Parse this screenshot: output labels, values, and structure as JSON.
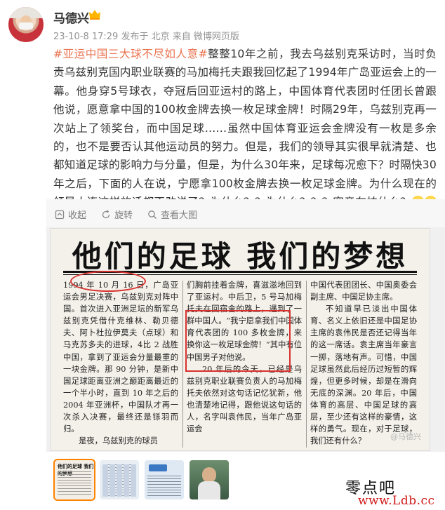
{
  "header": {
    "username": "马德兴",
    "meta": "23-10-8 17:29 发布于 北京 来自 微博网页版"
  },
  "post": {
    "hashtag": "#亚运中国三大球不尽如人意#",
    "body": "整整10年之前，我去乌兹别克采访时，当时负责乌兹别克国内职业联赛的马加梅托夫跟我回忆起了1994年广岛亚运会上的一幕。他身穿5号球衣，夺冠后回亚运村的路上，中国体育代表团时任团长曾跟他说，愿意拿中国的100枚金牌去换一枚足球金牌！时隔29年，乌兹别克再一次站上了领奖台，而中国足球……虽然中国体育亚运会金牌没有一枚是多余的，也不是要否认其他运动员的努力。但是，我们的领导其实很早就清楚、也都知道足球的影响力与分量，但是，为什么30年来，足球每况愈下？时隔快30年之后，下面的人在说，宁愿拿100枚金牌去换一枚足球金牌。为什么现在的领导人连这样的话都不敢说了？为什么？？为什么？？？究竟在怕什么？"
  },
  "toolbar": {
    "collect": "收起",
    "rotate": "旋转",
    "view_large": "查看大图"
  },
  "newspaper": {
    "headline": "他们的足球 我们的梦想",
    "col1": [
      "1994 年 10 月 16 日，广岛亚运会男足决赛，乌兹别克对阵中国。首次进入亚洲足坛的新军乌兹别克凭借什克维林、勒贝德夫、阿卜杜拉伊莫夫（点球）和马克苏多夫的进球，4比 2 战胜中国，拿到了亚运会分量最重的一块金牌。那 90 分钟，是新中国足球距离亚洲之巅距离最近的一个半小时，直到 10 年之后的 2004 年亚洲杯，中国队才再一次杀入决赛，最终还是铩羽而归。",
      "是夜，乌兹别克的球员"
    ],
    "col2": [
      "们胸前挂着金牌，喜滋滋地回到了亚运村。中后卫，5 号马加梅托夫在回宿舍的路上，遇到了一群中国人。“我宁愿拿我们中国体育代表团的 100 多枚金牌，来换你这一枚足球金牌！”其中有位中国男子对他说。",
      "20 年后的今天，已经是乌兹别克职业联赛负责人的马加梅托夫依然对这句话记忆犹新，他也清楚地记得，跟他说这句话的人，名字叫袁伟民，当年广岛亚运会"
    ],
    "col3": [
      "中国代表团团长、中国奥委会副主席、中国足协主席。",
      "不知道早已淡出中国体育、名义上依旧还是中国足协主席的袁伟民是否还记得当年的这一席话。袁主席当年豪言一掷，落地有声。可惜，中国足球虽然此后经历过短暂的辉煌，但更多时候，却是在滑向无底的深渊。20 年后，中国体育的高层、中国足球的高层，至少还有这样的豪情，这样的勇气。现在，对于足球，我们还有什么？"
    ],
    "watermark": "@马德兴"
  },
  "brand": {
    "name": "零点吧",
    "url": "www.Ldb.cc"
  }
}
